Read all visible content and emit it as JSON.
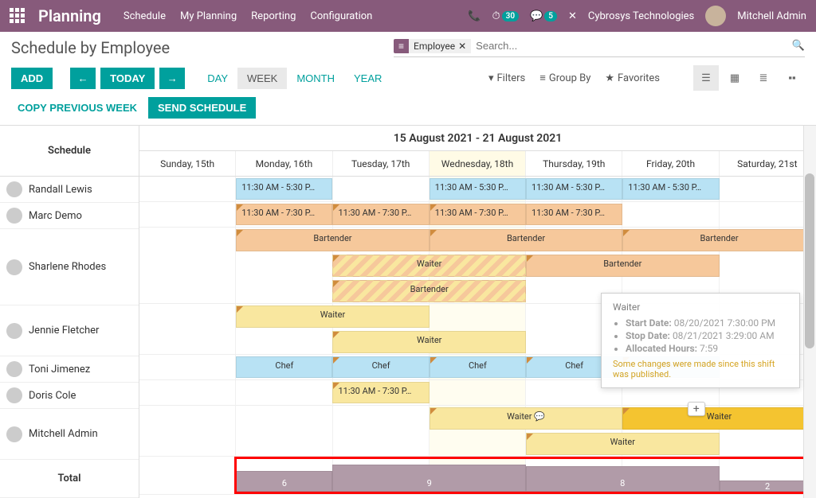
{
  "topbar": {
    "brand": "Planning",
    "menu": [
      "Schedule",
      "My Planning",
      "Reporting",
      "Configuration"
    ],
    "notif1": "30",
    "notif2": "5",
    "company": "Cybrosys Technologies",
    "user": "Mitchell Admin"
  },
  "page": {
    "title": "Schedule by Employee",
    "facet_label": "≡",
    "facet_value": "Employee",
    "search_placeholder": "Search..."
  },
  "toolbar": {
    "add": "ADD",
    "today": "TODAY",
    "day": "DAY",
    "week": "WEEK",
    "month": "MONTH",
    "year": "YEAR",
    "copy": "COPY PREVIOUS WEEK",
    "send": "SEND SCHEDULE",
    "filters": "Filters",
    "groupby": "Group By",
    "favorites": "Favorites"
  },
  "gantt": {
    "schedule_label": "Schedule",
    "date_range": "15 August 2021 - 21 August 2021",
    "days": [
      "Sunday, 15th",
      "Monday, 16th",
      "Tuesday, 17th",
      "Wednesday, 18th",
      "Thursday, 19th",
      "Friday, 20th",
      "Saturday, 21st"
    ],
    "today_index": 3,
    "employees": [
      "Randall Lewis",
      "Marc Demo",
      "Sharlene Rhodes",
      "Jennie Fletcher",
      "Toni Jimenez",
      "Doris Cole",
      "Mitchell Admin"
    ],
    "total_label": "Total",
    "shifts": {
      "randall_mon": "11:30 AM - 5:30 P…",
      "randall_wed": "11:30 AM - 5:30 P…",
      "randall_thu": "11:30 AM - 5:30 P…",
      "randall_fri": "11:30 AM - 5:30 P…",
      "marc_mon": "11:30 AM - 7:30 P…",
      "marc_tue": "11:30 AM - 7:30 P…",
      "marc_wed": "11:30 AM - 7:30 P…",
      "marc_thu": "11:30 AM - 7:30 P…",
      "bartender": "Bartender",
      "waiter": "Waiter",
      "chef": "Chef",
      "doris_tue": "11:30 AM - 7:30 P…"
    },
    "totals": {
      "t1": "6",
      "t2": "9",
      "t3": "8",
      "t4": "2"
    }
  },
  "tooltip": {
    "title": "Waiter",
    "start_k": "Start Date:",
    "start_v": "08/20/2021 7:30:00 PM",
    "stop_k": "Stop Date:",
    "stop_v": "08/21/2021 3:29:00 AM",
    "alloc_k": "Allocated Hours:",
    "alloc_v": "7:59",
    "behind": "Chef",
    "warn": "Some changes were made since this shift was published."
  }
}
